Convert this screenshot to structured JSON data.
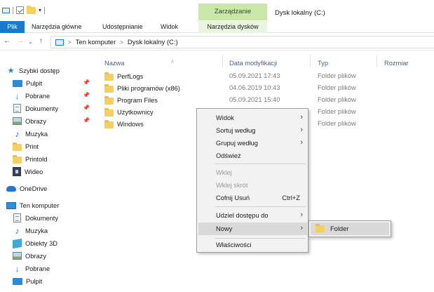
{
  "window": {
    "contextual_tab_group": "Zarządzanie",
    "title": "Dysk lokalny (C:)"
  },
  "ribbon": {
    "tabs": [
      "Plik",
      "Narzędzia główne",
      "Udostępnianie",
      "Widok",
      "Narzędzia dysków"
    ]
  },
  "address": {
    "crumbs": [
      "Ten komputer",
      "Dysk lokalny (C:)"
    ],
    "separator": ">"
  },
  "nav": {
    "items": [
      {
        "label": "Szybki dostęp",
        "icon": "star-icon",
        "pinned": false
      },
      {
        "label": "Pulpit",
        "icon": "desktop-icon",
        "pinned": true
      },
      {
        "label": "Pobrane",
        "icon": "download-icon",
        "pinned": true
      },
      {
        "label": "Dokumenty",
        "icon": "document-icon",
        "pinned": true
      },
      {
        "label": "Obrazy",
        "icon": "pictures-icon",
        "pinned": true
      },
      {
        "label": "Muzyka",
        "icon": "music-icon",
        "pinned": false
      },
      {
        "label": "Print",
        "icon": "folder-icon",
        "pinned": false
      },
      {
        "label": "Printold",
        "icon": "folder-icon",
        "pinned": false
      },
      {
        "label": "Wideo",
        "icon": "video-icon",
        "pinned": false
      },
      {
        "label": "OneDrive",
        "icon": "cloud-icon",
        "pinned": false
      },
      {
        "label": "Ten komputer",
        "icon": "computer-icon",
        "pinned": false
      },
      {
        "label": "Dokumenty",
        "icon": "document-icon",
        "pinned": false
      },
      {
        "label": "Muzyka",
        "icon": "music-icon",
        "pinned": false
      },
      {
        "label": "Obiekty 3D",
        "icon": "3d-objects-icon",
        "pinned": false
      },
      {
        "label": "Obrazy",
        "icon": "pictures-icon",
        "pinned": false
      },
      {
        "label": "Pobrane",
        "icon": "download-icon",
        "pinned": false
      },
      {
        "label": "Pulpit",
        "icon": "desktop-icon",
        "pinned": false
      }
    ],
    "pin_glyph": "📌"
  },
  "columns": {
    "name": "Nazwa",
    "date": "Data modyfikacji",
    "type": "Typ",
    "size": "Rozmiar"
  },
  "files": [
    {
      "name": "PerfLogs",
      "date": "05.09.2021 17:43",
      "type": "Folder plików"
    },
    {
      "name": "Pliki programów (x86)",
      "date": "04.06.2019 10:43",
      "type": "Folder plików"
    },
    {
      "name": "Program Files",
      "date": "05.09.2021 15:40",
      "type": "Folder plików"
    },
    {
      "name": "Użytkownicy",
      "date": "",
      "type": "Folder plików"
    },
    {
      "name": "Windows",
      "date": "",
      "type": "Folder plików"
    }
  ],
  "context_menu": {
    "view": "Widok",
    "sort_by": "Sortuj według",
    "group_by": "Grupuj według",
    "refresh": "Odśwież",
    "paste": "Wklej",
    "paste_shortcut": "Wklej skrót",
    "undo_delete": "Cofnij Usuń",
    "undo_shortcut": "Ctrl+Z",
    "give_access": "Udziel dostępu do",
    "new": "Nowy",
    "properties": "Właściwości",
    "arrow": "›"
  },
  "submenu": {
    "folder": "Folder"
  },
  "colors": {
    "file_tab": "#1979ca",
    "contextual_tab": "#c8e7a9",
    "menu_bg": "#f2f2f2",
    "menu_highlight": "#d9d9d9"
  }
}
